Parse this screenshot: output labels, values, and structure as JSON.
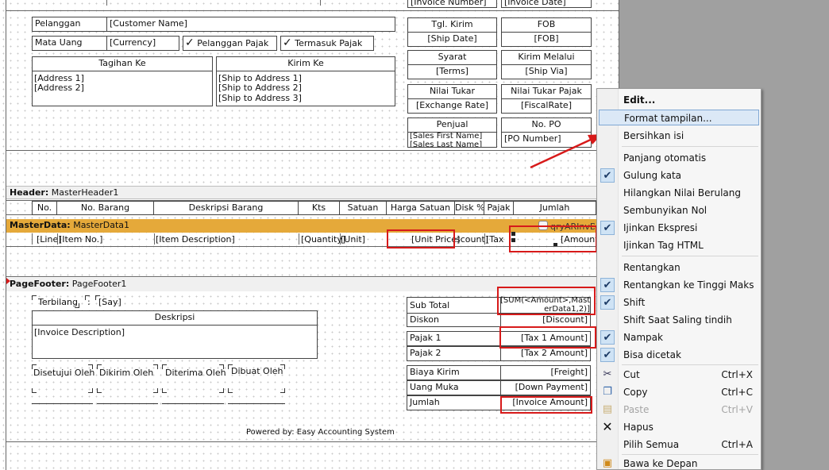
{
  "header_fields": {
    "invoice_number": "[Invoice Number]",
    "invoice_date": "[Invoice Date]",
    "pelanggan_label": "Pelanggan",
    "pelanggan_value": "[Customer Name]",
    "mata_uang_label": "Mata Uang",
    "mata_uang_value": "[Currency]",
    "pelanggan_pajak": "Pelanggan Pajak",
    "termasuk_pajak": "Termasuk Pajak",
    "tagihan_ke": "Tagihan Ke",
    "kirim_ke": "Kirim Ke",
    "address1": "[Address 1]",
    "address2": "[Address 2]",
    "ship1": "[Ship to Address 1]",
    "ship2": "[Ship to Address 2]",
    "ship3": "[Ship to Address 3]",
    "tgl_kirim": "Tgl. Kirim",
    "ship_date": "[Ship Date]",
    "fob": "FOB",
    "fob_value": "[FOB]",
    "syarat": "Syarat",
    "terms": "[Terms]",
    "kirim_melalui": "Kirim Melalui",
    "ship_via": "[Ship Via]",
    "nilai_tukar": "Nilai Tukar",
    "exchange_rate": "[Exchange Rate]",
    "nilai_tukar_pajak": "Nilai Tukar Pajak",
    "fiscal_rate": "[FiscalRate]",
    "penjual": "Penjual",
    "sales_first": "[Sales First Name]",
    "sales_last": "[Sales Last Name]",
    "no_po": "No. PO",
    "po_number": "[PO Number]"
  },
  "bands": {
    "header_label": "Header:",
    "header_name": "MasterHeader1",
    "masterdata_label": "MasterData:",
    "masterdata_name": "MasterData1",
    "masterdata_query": "qryARInvD",
    "pagefooter_label": "PageFooter:",
    "pagefooter_name": "PageFooter1"
  },
  "columns": [
    "No.",
    "No. Barang",
    "Deskripsi Barang",
    "Kts",
    "Satuan",
    "Harga Satuan",
    "Disk %",
    "Pajak",
    "Jumlah"
  ],
  "data_row": [
    "[Line]",
    "[Item No.]",
    "[Item Description]",
    "[Quantity]",
    "[Unit]",
    "[Unit Price]",
    "scount]",
    "[Tax",
    "[Amount"
  ],
  "footer": {
    "terbilang": "Terbilang",
    "colon": ":",
    "say": "[Say]",
    "deskripsi": "Deskripsi",
    "invoice_description": "[Invoice Description]",
    "disetujui": "Disetujui Oleh",
    "dikirim": "Dikirim Oleh",
    "diterima": "Diterima Oleh",
    "dibuat": "Dibuat Oleh",
    "powered_by": "Powered by: Easy Accounting System",
    "sub_total": "Sub Total",
    "sub_total_value_1": "[SUM(<Amount>,Mast",
    "sub_total_value_2": "erData1,2)]",
    "diskon": "Diskon",
    "discount": "[Discount]",
    "pajak1": "Pajak 1",
    "tax1": "[Tax 1 Amount]",
    "pajak2": "Pajak 2",
    "tax2": "[Tax 2 Amount]",
    "biaya_kirim": "Biaya Kirim",
    "freight": "[Freight]",
    "uang_muka": "Uang Muka",
    "down_payment": "[Down Payment]",
    "jumlah": "Jumlah",
    "invoice_amount": "[Invoice Amount]"
  },
  "context_menu": {
    "edit": "Edit...",
    "format_tampilan": "Format tampilan...",
    "bersihkan_isi": "Bersihkan isi",
    "panjang_otomatis": "Panjang otomatis",
    "gulung_kata": "Gulung kata",
    "hilangkan_nilai_berulang": "Hilangkan Nilai Berulang",
    "sembunyikan_nol": "Sembunyikan Nol",
    "ijinkan_ekspresi": "Ijinkan Ekspresi",
    "ijinkan_tag_html": "Ijinkan Tag HTML",
    "rentangkan": "Rentangkan",
    "rentangkan_ke_tinggi_maks": "Rentangkan ke Tinggi Maks",
    "shift": "Shift",
    "shift_saat_saling_tindih": "Shift Saat Saling tindih",
    "nampak": "Nampak",
    "bisa_dicetak": "Bisa dicetak",
    "cut": "Cut",
    "cut_shortcut": "Ctrl+X",
    "copy": "Copy",
    "copy_shortcut": "Ctrl+C",
    "paste": "Paste",
    "paste_shortcut": "Ctrl+V",
    "hapus": "Hapus",
    "pilih_semua": "Pilih Semua",
    "pilih_semua_shortcut": "Ctrl+A",
    "bawa_ke_depan": "Bawa ke Depan"
  },
  "colors": {
    "masterdata_band": "#e5a93a",
    "highlight": "#d71a1a",
    "menu_hover": "#dbe8f6"
  }
}
